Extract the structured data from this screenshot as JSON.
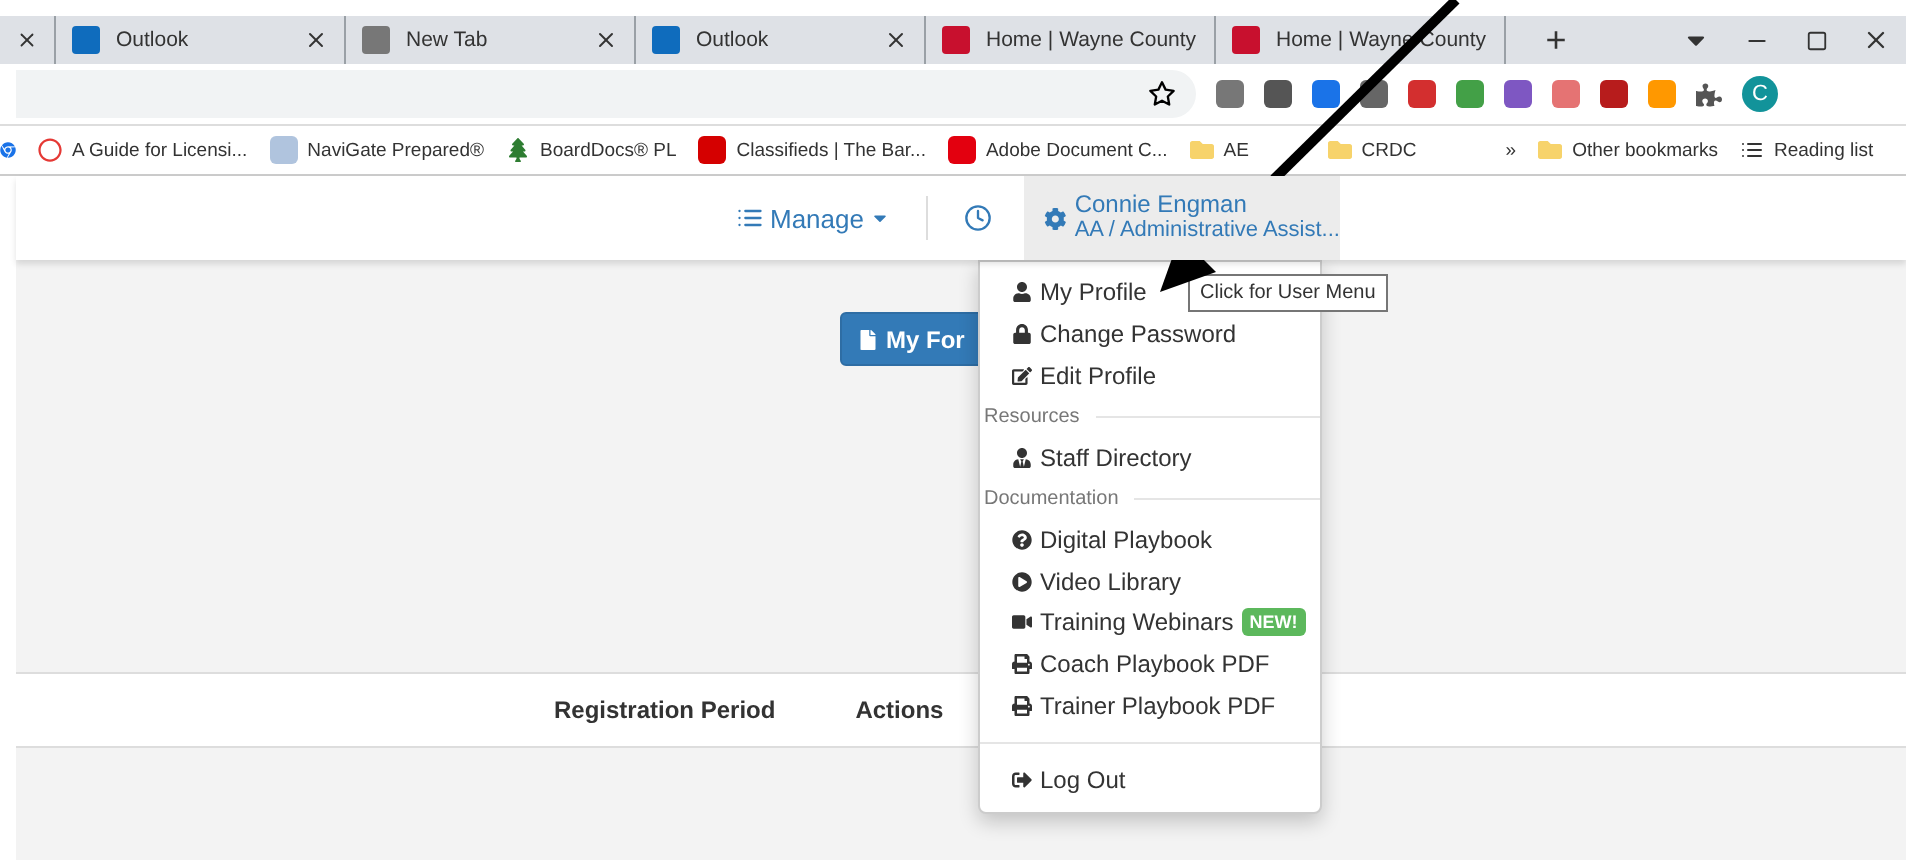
{
  "browser": {
    "tabs": [
      {
        "kind": "partial"
      },
      {
        "title": "Outlook",
        "kind": "outlook"
      },
      {
        "title": "New Tab",
        "kind": "newtab"
      },
      {
        "title": "Outlook",
        "kind": "outlook"
      },
      {
        "title": "Home | Wayne County",
        "kind": "star"
      },
      {
        "title": "Home | Wayne County",
        "kind": "star"
      }
    ],
    "new_tab": "+",
    "bookmarks": [
      {
        "label": "A Guide for Licensi...",
        "kind": "ring"
      },
      {
        "label": "NaviGate Prepared®",
        "kind": "wave"
      },
      {
        "label": "BoardDocs® PL",
        "kind": "tree"
      },
      {
        "label": "Classifieds | The Bar...",
        "kind": "bh"
      },
      {
        "label": "Adobe Document C...",
        "kind": "adobe"
      },
      {
        "label": "AE",
        "kind": "folder"
      },
      {
        "label": "CRDC",
        "kind": "folder"
      }
    ],
    "overflow": "»",
    "other_bookmarks": "Other bookmarks",
    "reading_list": "Reading list",
    "profile_initial": "C"
  },
  "header": {
    "manage": "Manage",
    "user_name": "Connie Engman",
    "user_role": "AA / Administrative Assist..."
  },
  "my_forms_button": "My For",
  "table": {
    "columns": [
      "Registration Period",
      "Actions"
    ]
  },
  "tooltip": "Click for User Menu",
  "user_menu": [
    {
      "kind": "item",
      "label": "My Profile"
    },
    {
      "kind": "item",
      "label": "Change Password"
    },
    {
      "kind": "item",
      "label": "Edit Profile"
    },
    {
      "kind": "header",
      "label": "Resources"
    },
    {
      "kind": "item",
      "label": "Staff Directory"
    },
    {
      "kind": "header",
      "label": "Documentation"
    },
    {
      "kind": "item",
      "label": "Digital Playbook"
    },
    {
      "kind": "item",
      "label": "Video Library"
    },
    {
      "kind": "item",
      "label": "Training Webinars",
      "badge": "NEW!"
    },
    {
      "kind": "item",
      "label": "Coach Playbook PDF"
    },
    {
      "kind": "item",
      "label": "Trainer Playbook PDF"
    },
    {
      "kind": "divider"
    },
    {
      "kind": "item",
      "label": "Log Out"
    }
  ]
}
